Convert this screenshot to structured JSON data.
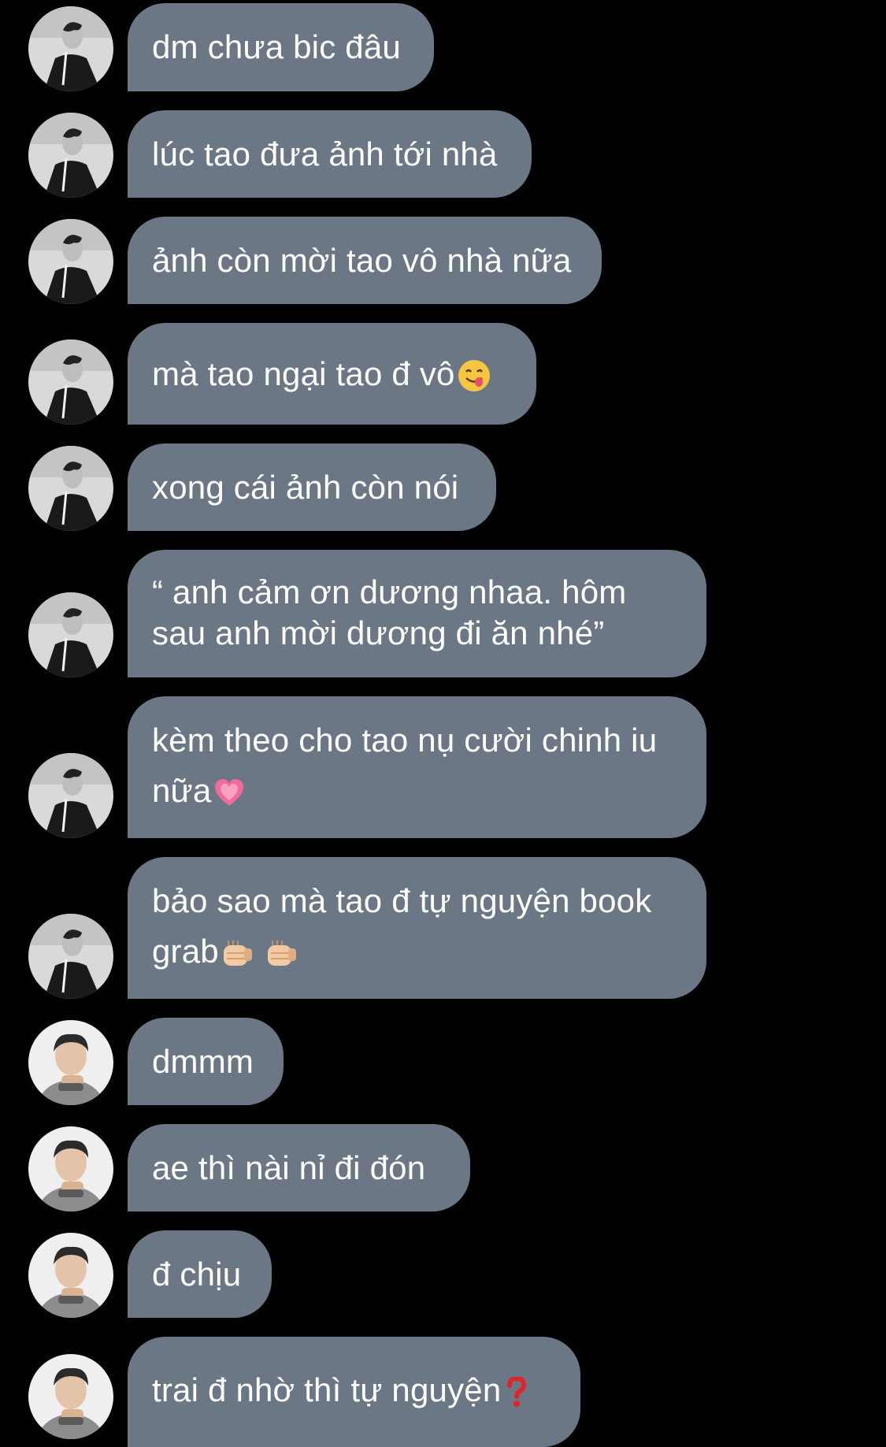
{
  "colors": {
    "background": "#000000",
    "bubble": "#6b7785",
    "bubble_text": "#ffffff"
  },
  "messages": [
    {
      "sender": "a",
      "text": "dm chưa bic đâu",
      "emoji": []
    },
    {
      "sender": "a",
      "text": "lúc tao đưa ảnh tới nhà",
      "emoji": []
    },
    {
      "sender": "a",
      "text": "ảnh còn mời tao vô nhà nữa",
      "emoji": []
    },
    {
      "sender": "a",
      "text": "mà tao ngại tao đ vô",
      "emoji": [
        "savoring-food-face-emoji"
      ]
    },
    {
      "sender": "a",
      "text": "xong cái ảnh còn nói",
      "emoji": []
    },
    {
      "sender": "a",
      "text": "“ anh cảm ơn dương nhaa. hôm\nsau anh mời dương đi ăn nhé”",
      "emoji": []
    },
    {
      "sender": "a",
      "text": "kèm theo cho tao nụ cười chinh iu\nnữa",
      "emoji": [
        "growing-heart-emoji"
      ]
    },
    {
      "sender": "a",
      "text": "bảo sao mà tao đ tự nguyện book\ngrab",
      "emoji": [
        "fist-bump-emoji",
        "fist-bump-emoji"
      ]
    },
    {
      "sender": "b",
      "text": "dmmm",
      "emoji": []
    },
    {
      "sender": "b",
      "text": "ae thì nài nỉ đi đón",
      "emoji": []
    },
    {
      "sender": "b",
      "text": "đ chịu",
      "emoji": []
    },
    {
      "sender": "b",
      "text": "trai đ nhờ thì tự nguyện",
      "emoji": [
        "red-question-mark-emoji"
      ]
    }
  ]
}
